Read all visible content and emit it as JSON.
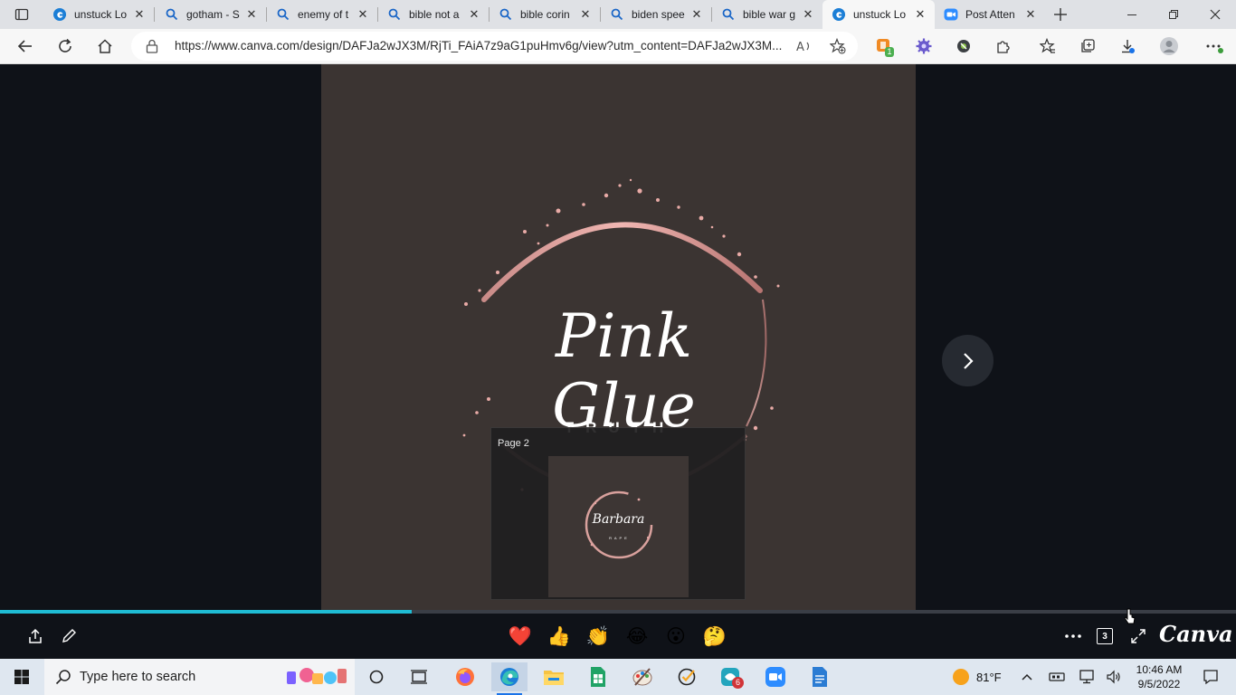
{
  "browser": {
    "tabs": [
      {
        "label": "unstuck Lo",
        "icon": "edge-e-icon"
      },
      {
        "label": "gotham - S",
        "icon": "search-icon"
      },
      {
        "label": "enemy of t",
        "icon": "search-icon"
      },
      {
        "label": "bible not a",
        "icon": "search-icon"
      },
      {
        "label": "bible corin",
        "icon": "search-icon"
      },
      {
        "label": "biden spee",
        "icon": "search-icon"
      },
      {
        "label": "bible war g",
        "icon": "search-icon"
      },
      {
        "label": "unstuck Lo",
        "icon": "edge-e-icon",
        "active": true
      },
      {
        "label": "Post Atten",
        "icon": "zoom-icon"
      }
    ],
    "address": "https://www.canva.com/design/DAFJa2wJX3M/RjTi_FAiA7z9aG1puHmv6g/view?utm_content=DAFJa2wJX3M...",
    "badge_extension_count": "1"
  },
  "design": {
    "title": "Pink Glue",
    "subtitle": "TRUTH",
    "thumbnail": {
      "label": "Page 2",
      "logo_text": "Barbara",
      "logo_sub": "R A P E"
    }
  },
  "viewer": {
    "progress": 0.333,
    "page_count_badge": "3",
    "brand": "Canva",
    "reactions": [
      "❤️",
      "👍",
      "👏",
      "😂",
      "😮",
      "🤔"
    ]
  },
  "taskbar": {
    "search_placeholder": "Type here to search",
    "weather": "81°F",
    "time": "10:46 AM",
    "date": "9/5/2022",
    "teams_badge": "6"
  },
  "colors": {
    "canvas_bg": "#3b3432",
    "viewer_bg": "#0f1218",
    "progress": "#1fbcd4",
    "rose_gold": "#e3a6a3"
  }
}
